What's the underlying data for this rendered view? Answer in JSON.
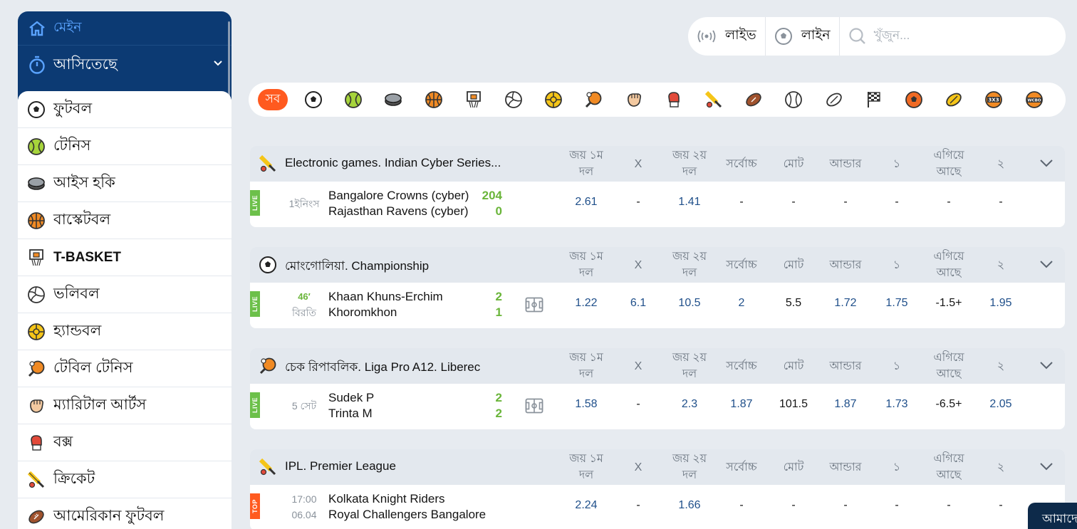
{
  "sidebar": {
    "main_label": "মেইন",
    "upcoming_label": "আসিতেছে",
    "sports": [
      {
        "label": "ফুটবল",
        "icon": "football-icon"
      },
      {
        "label": "টেনিস",
        "icon": "tennis-icon"
      },
      {
        "label": "আইস হকি",
        "icon": "ice-hockey-icon"
      },
      {
        "label": "বাস্কেটবল",
        "icon": "basketball-icon"
      },
      {
        "label": "T-BASKET",
        "icon": "t-basket-icon"
      },
      {
        "label": "ভলিবল",
        "icon": "volleyball-icon"
      },
      {
        "label": "হ্যান্ডবল",
        "icon": "handball-icon"
      },
      {
        "label": "টেবিল টেনিস",
        "icon": "table-tennis-icon"
      },
      {
        "label": "ম্যারিটাল আর্টস",
        "icon": "martial-arts-icon"
      },
      {
        "label": "বক্স",
        "icon": "boxing-icon"
      },
      {
        "label": "ক্রিকেট",
        "icon": "cricket-icon"
      },
      {
        "label": "আমেরিকান ফুটবল",
        "icon": "american-football-icon"
      }
    ]
  },
  "topbar": {
    "live_label": "লাইভ",
    "line_label": "লাইন",
    "search_placeholder": "খুঁজুন..."
  },
  "filter": {
    "all_label": "সব",
    "icons": [
      "football-icon",
      "tennis-icon",
      "ice-hockey-icon",
      "basketball-icon",
      "t-basket-icon",
      "volleyball-icon",
      "handball-icon",
      "table-tennis-icon",
      "martial-arts-icon",
      "boxing-icon",
      "cricket-icon",
      "american-football-icon",
      "baseball-icon",
      "rugby-icon",
      "motorsport-icon",
      "futsal-icon",
      "aussie-rules-icon",
      "3x3-basketball-icon",
      "wcbo-icon"
    ]
  },
  "columns": {
    "win1_a": "জয় ১ম",
    "win1_b": "দল",
    "draw": "X",
    "win2_a": "জয় ২য়",
    "win2_b": "দল",
    "max": "সর্বোচ্চ",
    "total": "মোট",
    "under": "আন্ডার",
    "one": "১",
    "lead_a": "এগিয়ে",
    "lead_b": "আছে",
    "two": "২"
  },
  "events": [
    {
      "league": "Electronic games. Indian Cyber Series...",
      "league_icon": "cricket-icon",
      "tag": "LIVE",
      "status_line1": "",
      "status_line2": "1ইনিংস",
      "team1": "Bangalore Crowns (cyber)",
      "team2": "Rajasthan Ravens (cyber)",
      "score1": "204",
      "score2": "0",
      "has_field": false,
      "odds": [
        "2.61",
        "-",
        "1.41",
        "-",
        "-",
        "-",
        "-",
        "-",
        "-"
      ]
    },
    {
      "league": "মোংগোলিয়া. Championship",
      "league_icon": "football-icon",
      "tag": "LIVE",
      "status_line1": "46′",
      "status_line2": "বিরতি",
      "team1": "Khaan Khuns-Erchim",
      "team2": "Khoromkhon",
      "score1": "2",
      "score2": "1",
      "has_field": true,
      "odds": [
        "1.22",
        "6.1",
        "10.5",
        "2",
        "5.5",
        "1.72",
        "1.75",
        "-1.5+",
        "1.95"
      ]
    },
    {
      "league": "চেক রিপাবলিক. Liga Pro A12. Liberec",
      "league_icon": "table-tennis-icon",
      "tag": "LIVE",
      "status_line1": "",
      "status_line2": "5 সেট",
      "team1": "Sudek P",
      "team2": "Trinta M",
      "score1": "2",
      "score2": "2",
      "has_field": true,
      "odds": [
        "1.58",
        "-",
        "2.3",
        "1.87",
        "101.5",
        "1.87",
        "1.73",
        "-6.5+",
        "2.05"
      ]
    },
    {
      "league": "IPL. Premier League",
      "league_icon": "cricket-icon",
      "tag": "TOP",
      "status_line1": "17:00",
      "status_line2": "06.04",
      "team1": "Kolkata Knight Riders",
      "team2": "Royal Challengers Bangalore",
      "score1": "",
      "score2": "",
      "has_field": false,
      "odds": [
        "2.24",
        "-",
        "1.66",
        "-",
        "-",
        "-",
        "-",
        "-",
        "-"
      ]
    }
  ],
  "chat_label": "আমাদে",
  "colors": {
    "accent": "#ff5a1f",
    "sidebar_bg": "#0c3a73",
    "live": "#6cc04a",
    "odd": "#1f4f8a"
  }
}
